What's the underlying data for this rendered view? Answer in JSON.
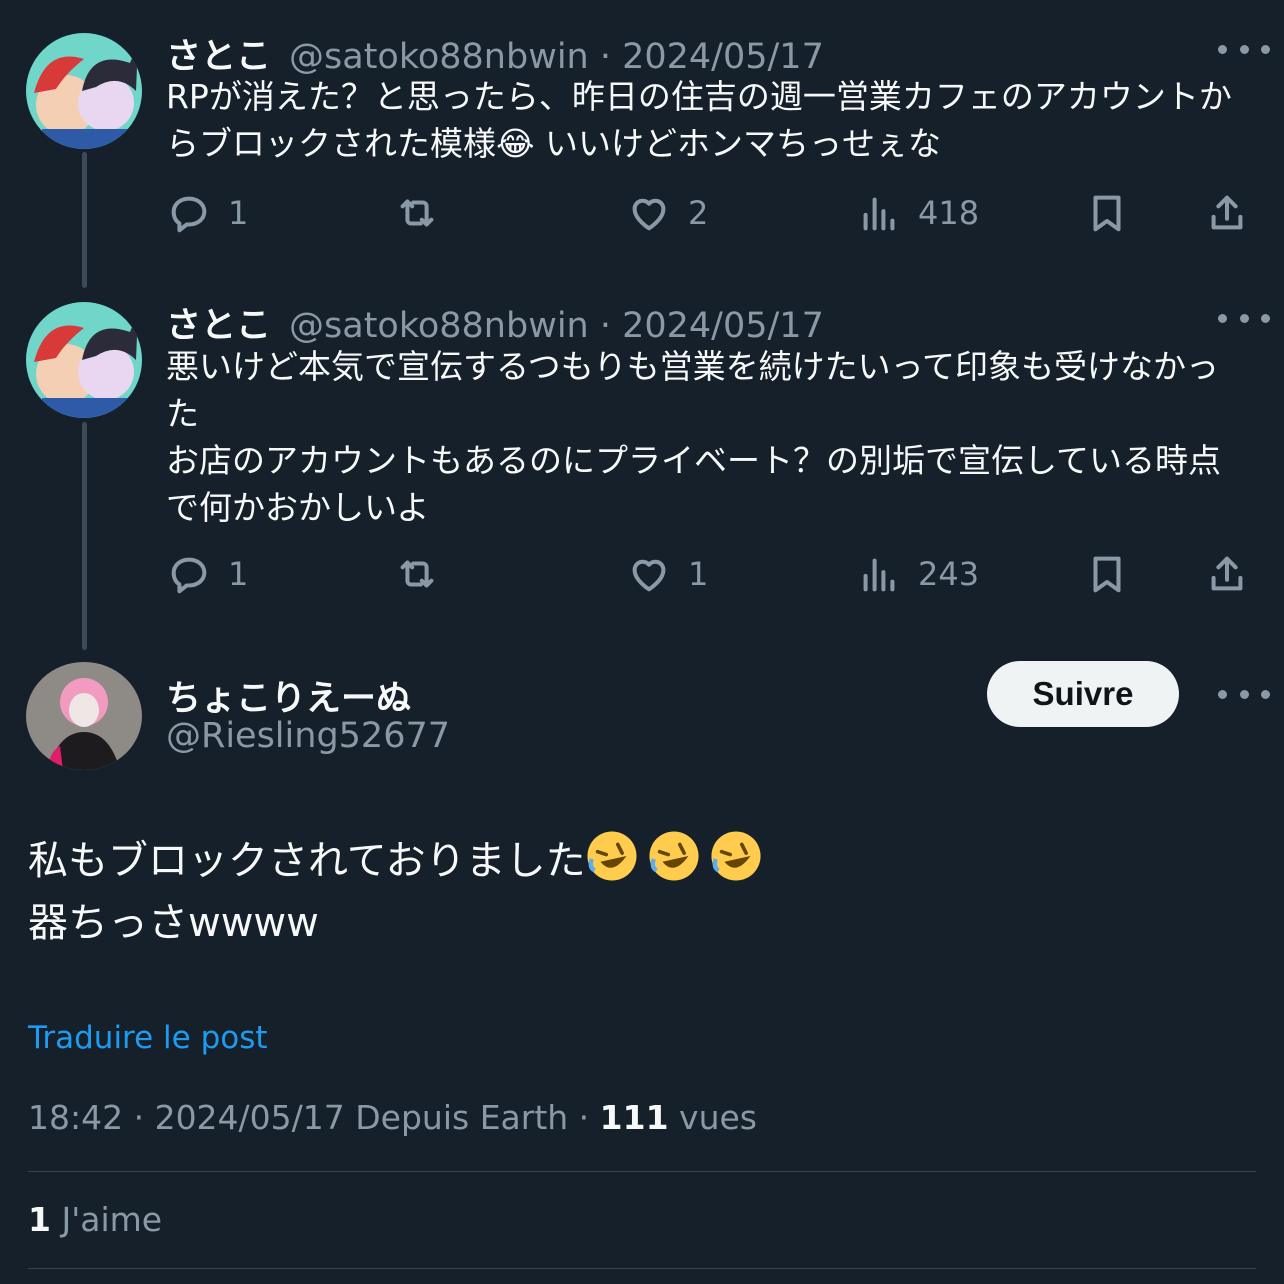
{
  "tweets": [
    {
      "name": "さとこ",
      "meta": "@satoko88nbwin · 2024/05/17",
      "text": "RPが消えた？と思ったら、昨日の住吉の週一営業カフェのアカウントからブロックされた模様😂 いいけどホンマちっせぇな",
      "replies": "1",
      "retweets": "",
      "likes": "2",
      "views": "418"
    },
    {
      "name": "さとこ",
      "meta": "@satoko88nbwin · 2024/05/17",
      "text": "悪いけど本気で宣伝するつもりも営業を続けたいって印象も受けなかった\nお店のアカウントもあるのにプライベート？の別垢で宣伝している時点で何かおかしいよ",
      "replies": "1",
      "retweets": "",
      "likes": "1",
      "views": "243"
    }
  ],
  "main": {
    "name": "ちょこりえーぬ",
    "handle": "@Riesling52677",
    "follow_label": "Suivre",
    "text_line1": "私もブロックされておりました",
    "text_line2": "器ちっさwwww",
    "emoji": "rolling-on-floor-laughing",
    "translate": "Traduire le post",
    "time": "18:42 · 2024/05/17 Depuis Earth · ",
    "views_count": "111",
    "views_label": " vues",
    "likes_count": "1",
    "likes_label": " J'aime"
  },
  "icons": [
    "reply-icon",
    "retweet-icon",
    "like-icon",
    "views-icon",
    "bookmark-icon",
    "share-icon",
    "more-icon"
  ],
  "colors": {
    "background": "#15202b",
    "accent": "#1d9bf0",
    "muted": "#8b98a5",
    "text": "#f7f9f9"
  }
}
